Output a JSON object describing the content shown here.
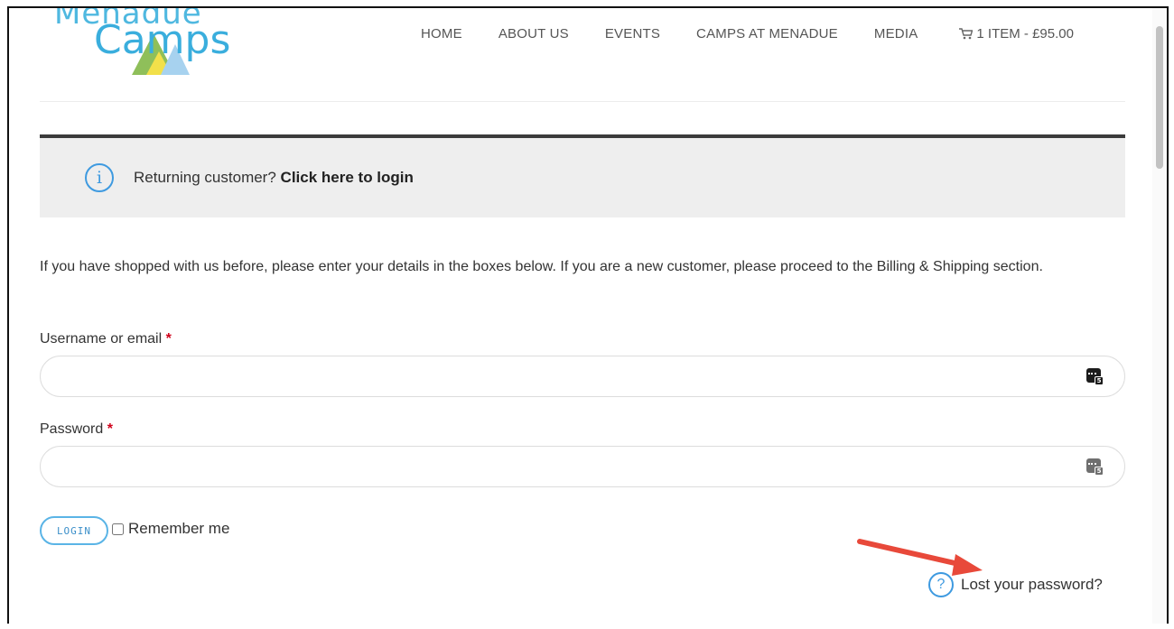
{
  "logo": {
    "top_text": "Menadue",
    "main_text": "Camps"
  },
  "nav": {
    "items": [
      "HOME",
      "ABOUT US",
      "EVENTS",
      "CAMPS AT MENADUE",
      "MEDIA"
    ],
    "cart_label": "1 ITEM - £95.00"
  },
  "notice": {
    "icon_glyph": "i",
    "text": "Returning customer?",
    "link_text": "Click here to login"
  },
  "intro_text": "If you have shopped with us before, please enter your details in the boxes below. If you are a new customer, please proceed to the Billing & Shipping section.",
  "form": {
    "username_label": "Username or email",
    "password_label": "Password",
    "required_mark": "*",
    "username_value": "",
    "password_value": "",
    "login_button": "LOGIN",
    "remember_label": "Remember me",
    "help_glyph": "?",
    "lost_password": "Lost your password?",
    "pw_badge": "5"
  },
  "colors": {
    "accent_blue": "#3e9ae0",
    "required_red": "#d0021b",
    "annotation_arrow": "#e8493a",
    "notice_bg": "#eeeeee"
  },
  "icons": {
    "notice": "info-circle-icon",
    "cart": "cart-icon",
    "password_manager": "password-manager-icon",
    "help": "question-circle-icon"
  }
}
